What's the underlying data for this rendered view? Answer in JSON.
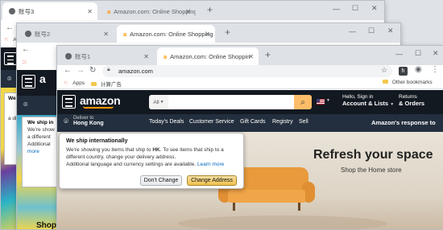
{
  "back_window_3": {
    "tab_label": "账号3",
    "partial_texts": {
      "we": "We",
      "ship": "We ship in",
      "showing": "We're show",
      "different": "a different",
      "additional": "Additional",
      "more": "more",
      "shop": "Shop",
      "s_letter": "S",
      "apps": "Apps"
    }
  },
  "back_window_2": {
    "tab_label": "账号2"
  },
  "tab_title": "Amazon.com: Online Shopping",
  "front_window": {
    "tab_label": "账号1",
    "active_tab_title": "Amazon.com: Online Shopping",
    "address": "amazon.com",
    "avatar_letter": "h",
    "bookmarks": {
      "apps": "Apps",
      "folder": "计算广告",
      "other": "Other bookmarks"
    }
  },
  "amazon": {
    "logo": "amazon",
    "deliver_to": "Deliver to",
    "location": "Hong Kong",
    "search_category": "All",
    "greeting": "Hello, Sign in",
    "account": "Account & Lists",
    "returns": "Returns",
    "orders": "& Orders",
    "nav": [
      "Today's Deals",
      "Customer Service",
      "Gift Cards",
      "Registry",
      "Sell"
    ],
    "covid_banner": "Amazon's response to",
    "hero_title": "Refresh your space",
    "hero_subtitle": "Shop the Home store"
  },
  "popover": {
    "title": "We ship internationally",
    "line1": "We're showing you items that ship to",
    "hk": "HK",
    "line1b": ". To see items that ship to a",
    "line2": "different country, change your delivery address.",
    "line3": "Additional language and currency settings are available.",
    "learn_more": "Learn more",
    "dont_change": "Don't Change",
    "change_address": "Change Address"
  },
  "colors": {
    "amazon_dark": "#131921",
    "amazon_nav": "#232f3e",
    "search_button": "#febd69",
    "accent_orange": "#ff9900",
    "change_btn": "#f0c14b"
  }
}
